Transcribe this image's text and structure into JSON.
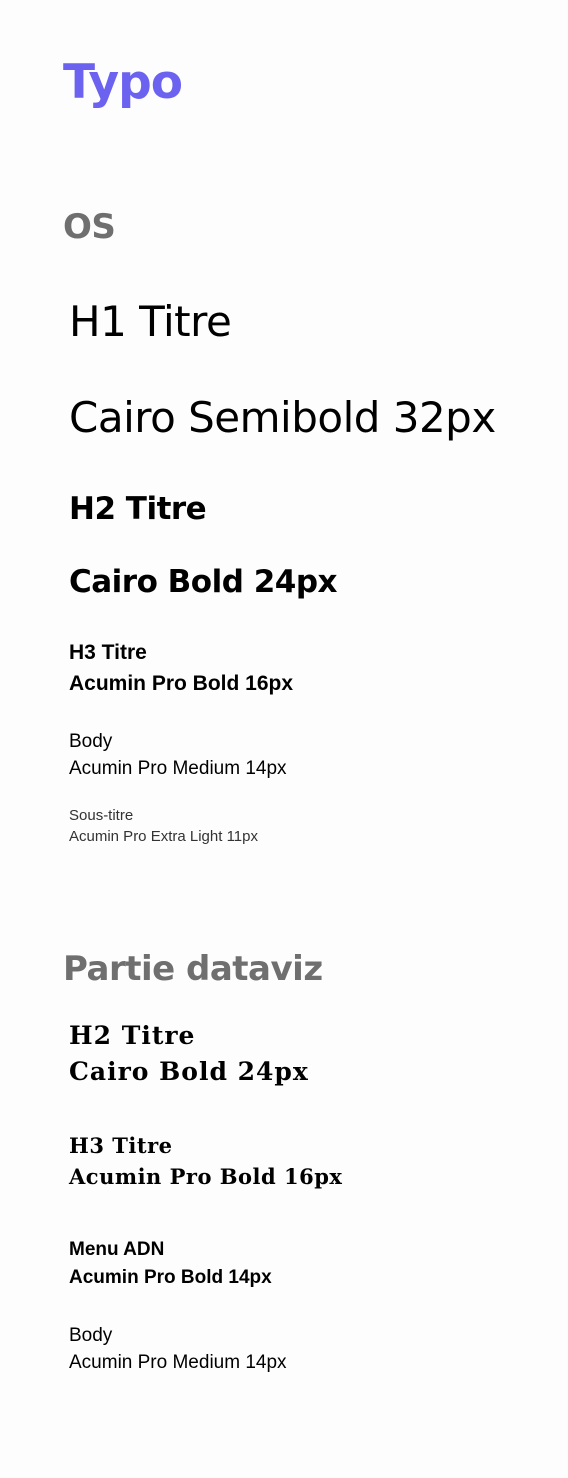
{
  "title": "Typo",
  "colors": {
    "accent": "#6c62f0",
    "section_heading": "#6f6f6f",
    "text": "#000000"
  },
  "os": {
    "heading": "OS",
    "h1_line1": "H1 Titre",
    "h1_line2": "Cairo Semibold 32px",
    "h2_line1": "H2 Titre",
    "h2_line2": "Cairo Bold 24px",
    "h3_line1": "H3 Titre",
    "h3_line2": "Acumin Pro Bold 16px",
    "body_line1": "Body",
    "body_line2": "Acumin Pro Medium 14px",
    "subtitle_line1": "Sous-titre",
    "subtitle_line2": "Acumin Pro Extra Light 11px"
  },
  "dataviz": {
    "heading": "Partie dataviz",
    "h2_line1": "H2 Titre",
    "h2_line2": "Cairo Bold 24px",
    "h3_line1": "H3 Titre",
    "h3_line2": "Acumin Pro Bold 16px",
    "menu_line1": "Menu ADN",
    "menu_line2": "Acumin Pro Bold 14px",
    "body_line1": "Body",
    "body_line2": "Acumin Pro Medium 14px"
  }
}
